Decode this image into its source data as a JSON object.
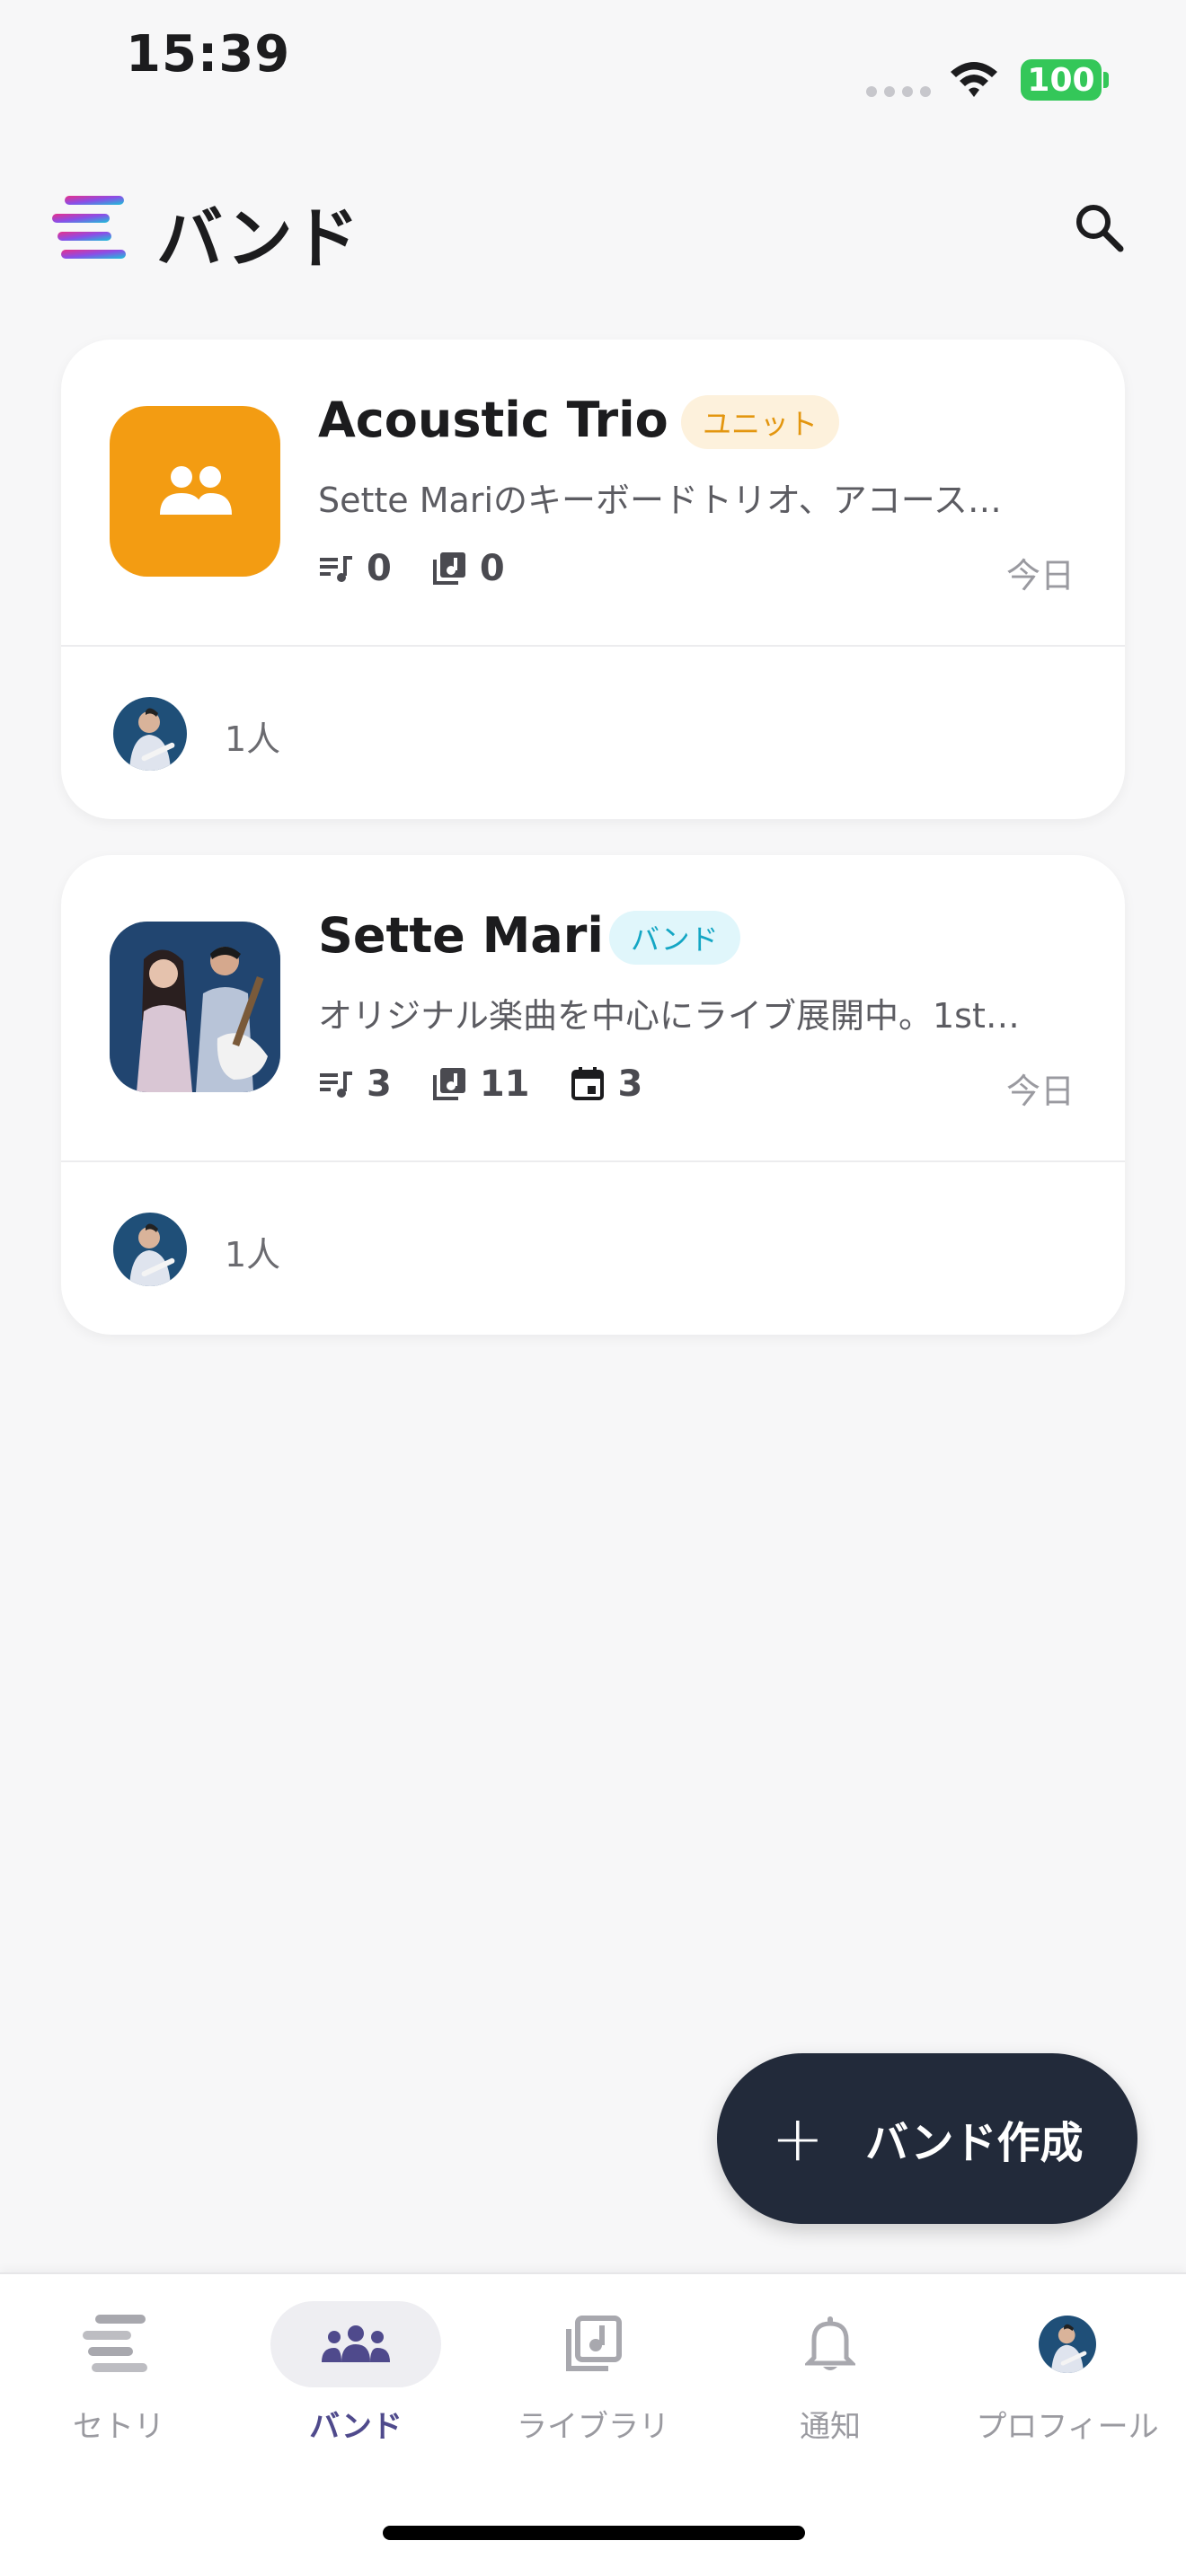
{
  "status_bar": {
    "time": "15:39",
    "battery": "100"
  },
  "header": {
    "title": "バンド"
  },
  "bands": [
    {
      "name": "Acoustic Trio",
      "badge": "ユニット",
      "description": "Sette Mariのキーボードトリオ、アコース…",
      "stats": {
        "setlists": "0",
        "songs": "0"
      },
      "date": "今日",
      "members": "1人"
    },
    {
      "name": "Sette Mari",
      "badge": "バンド",
      "description": "オリジナル楽曲を中心にライブ展開中。1st…",
      "stats": {
        "setlists": "3",
        "songs": "11",
        "events": "3"
      },
      "date": "今日",
      "members": "1人"
    }
  ],
  "fab": {
    "label": "バンド作成"
  },
  "nav": {
    "items": [
      {
        "label": "セトリ",
        "icon": "setlist-icon"
      },
      {
        "label": "バンド",
        "icon": "groups-icon",
        "active": true
      },
      {
        "label": "ライブラリ",
        "icon": "library-music-icon"
      },
      {
        "label": "通知",
        "icon": "bell-icon"
      },
      {
        "label": "プロフィール",
        "icon": "avatar"
      }
    ]
  },
  "colors": {
    "accent": "#4f4a8c",
    "unit_badge": "#e3960f",
    "band_badge": "#14a6c4",
    "fab": "#222a3a",
    "thumb_orange": "#f39c12",
    "battery": "#34c759"
  }
}
